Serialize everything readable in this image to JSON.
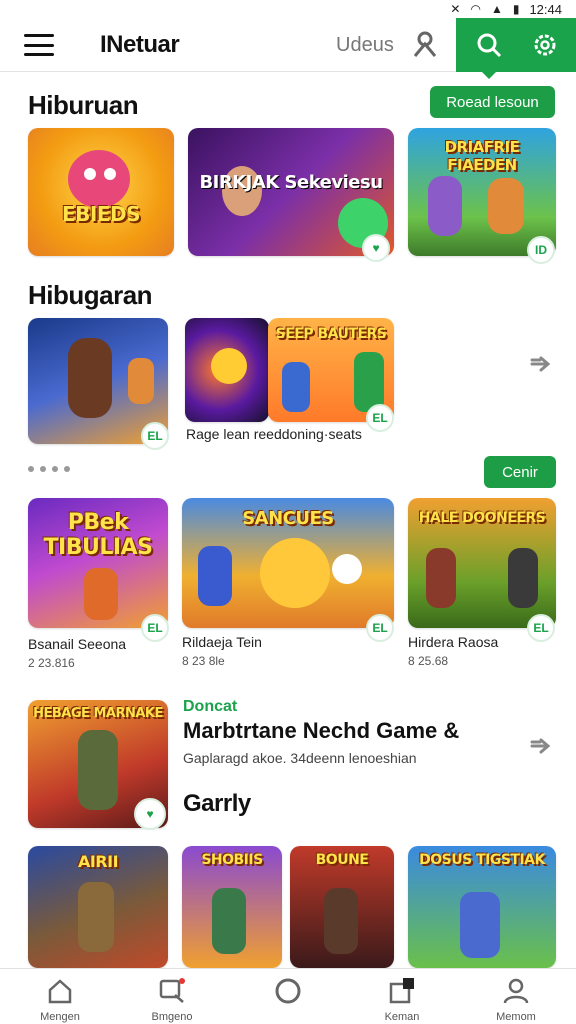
{
  "status_bar": {
    "time": "12:44"
  },
  "app_bar": {
    "title": "INetuar",
    "tab_label": "Udeus",
    "icons": [
      "menu-icon",
      "user-icon",
      "search-icon",
      "settings-icon"
    ],
    "accent_color": "#1aa34a"
  },
  "section1": {
    "title": "Hiburuan",
    "button_label": "Roead lesoun",
    "tiles": [
      {
        "art": "EBIEDS"
      },
      {
        "art": "BIRKJAK Sekeviesu"
      },
      {
        "art": "DRIAFRIE FIAEDEN"
      }
    ]
  },
  "section2": {
    "title": "Hibugaran",
    "caption": "Rage lean reeddoning·seats",
    "tiles": [
      {
        "art": ""
      },
      {
        "art": ""
      },
      {
        "art": "SEEP BAUTERS"
      }
    ],
    "badges": [
      "EL",
      "EL"
    ]
  },
  "section3": {
    "button_label": "Cenir",
    "items": [
      {
        "art": "PBek TIBULIAS",
        "name": "Bsanail Seeona",
        "meta": "2 23.816",
        "badge": "EL"
      },
      {
        "art": "SANCUES",
        "name": "Rildaeja Tein",
        "meta": "8 23 8le",
        "badge": "EL"
      },
      {
        "art": "HALE DOONEERS",
        "name": "Hirdera Raosa",
        "meta": "8 25.68",
        "badge": "EL"
      }
    ]
  },
  "featured": {
    "art": "HEBAGE MARNAKE",
    "tag": "Doncat",
    "title": "Marbtrtane Nechd Game &",
    "subtitle": "Gaplaragd akoe. 34deenn lenoeshian",
    "section_title": "Garrly"
  },
  "section4": {
    "tiles": [
      {
        "art": "AIRII"
      },
      {
        "art": "SHOBIIS"
      },
      {
        "art": "BOUNE"
      },
      {
        "art": "DOSUS TIGSTIAK"
      }
    ]
  },
  "bottom_nav": {
    "items": [
      {
        "label": "Mengen",
        "icon": "home-icon"
      },
      {
        "label": "Bmgeno",
        "icon": "search-icon"
      },
      {
        "label": "",
        "icon": "circle-icon"
      },
      {
        "label": "Keman",
        "icon": "library-icon"
      },
      {
        "label": "Memom",
        "icon": "profile-icon"
      }
    ]
  }
}
